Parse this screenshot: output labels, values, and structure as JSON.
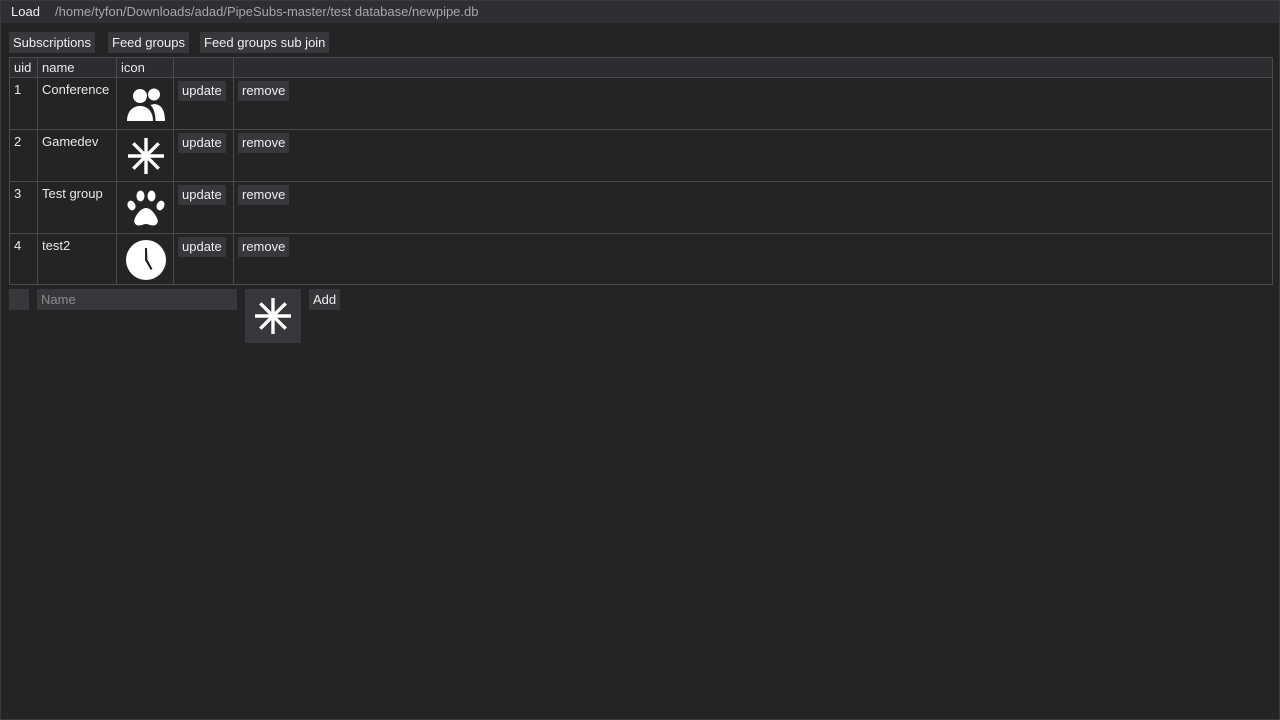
{
  "toolbar": {
    "load_label": "Load",
    "db_path": "/home/tyfon/Downloads/adad/PipeSubs-master/test database/newpipe.db"
  },
  "tabs": [
    {
      "label": "Subscriptions"
    },
    {
      "label": "Feed groups"
    },
    {
      "label": "Feed groups sub join"
    }
  ],
  "table": {
    "headers": {
      "uid": "uid",
      "name": "name",
      "icon": "icon"
    },
    "rows": [
      {
        "uid": "1",
        "name": "Conference",
        "icon": "people-icon",
        "update": "update",
        "remove": "remove"
      },
      {
        "uid": "2",
        "name": "Gamedev",
        "icon": "asterisk-icon",
        "update": "update",
        "remove": "remove"
      },
      {
        "uid": "3",
        "name": "Test group",
        "icon": "paw-icon",
        "update": "update",
        "remove": "remove"
      },
      {
        "uid": "4",
        "name": "test2",
        "icon": "clock-icon",
        "update": "update",
        "remove": "remove"
      }
    ]
  },
  "add_form": {
    "name_placeholder": "Name",
    "name_value": "",
    "icon": "asterisk-icon",
    "add_label": "Add"
  },
  "colors": {
    "background": "#242424",
    "topbar": "#2e2e33",
    "button": "#37373c",
    "border": "#4a4a4a",
    "text": "#efefef",
    "path_text": "#a8a8a8"
  }
}
